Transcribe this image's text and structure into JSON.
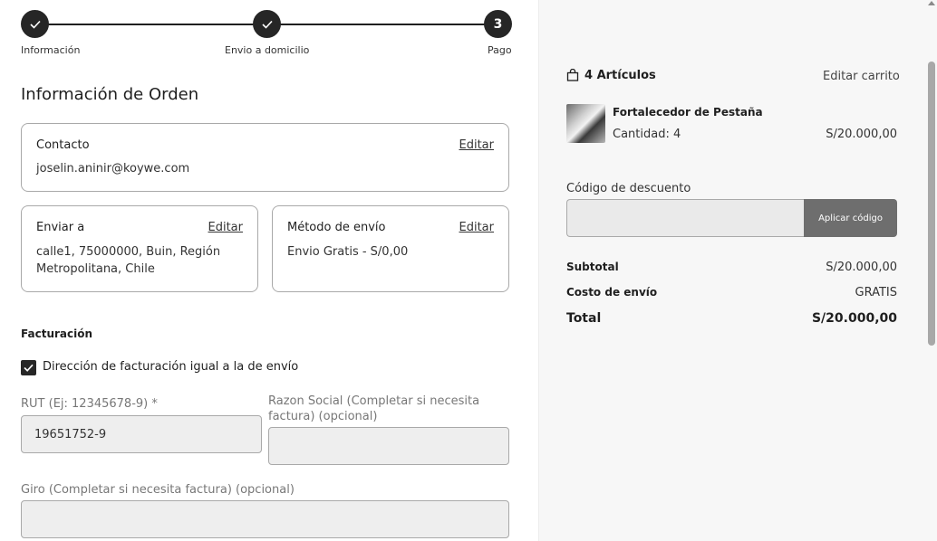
{
  "stepper": {
    "steps": [
      {
        "label": "Información",
        "state": "done",
        "icon": "check-icon"
      },
      {
        "label": "Envio a domicilio",
        "state": "done",
        "icon": "check-icon"
      },
      {
        "label": "Pago",
        "state": "current",
        "number": "3"
      }
    ]
  },
  "order": {
    "title": "Información de Orden",
    "contact": {
      "title": "Contacto",
      "edit": "Editar",
      "value": "joselin.aninir@koywe.com"
    },
    "ship_to": {
      "title": "Enviar a",
      "edit": "Editar",
      "line1": "calle1, 75000000, Buin, Región",
      "line2": "Metropolitana, Chile"
    },
    "ship_method": {
      "title": "Método de envío",
      "edit": "Editar",
      "value": "Envio Gratis - S/0,00"
    }
  },
  "billing": {
    "title": "Facturación",
    "same_as_shipping_label": "Dirección de facturación igual a la de envío",
    "same_as_shipping_checked": true,
    "rut_label": "RUT (Ej: 12345678-9) *",
    "rut_value": "19651752-9",
    "razon_label_1": "Razon Social (Completar si necesita",
    "razon_label_2": "factura) (opcional)",
    "razon_value": "",
    "giro_label": "Giro (Completar si necesita factura) (opcional)",
    "giro_value": ""
  },
  "cart": {
    "count_label": "4 Artículos",
    "edit_cart": "Editar carrito",
    "item": {
      "name": "Fortalecedor de Pestaña",
      "quantity": "Cantidad: 4",
      "price": "S/20.000,00"
    },
    "discount_label": "Código de descuento",
    "discount_placeholder": "",
    "apply_label": "Aplicar código",
    "subtotal_label": "Subtotal",
    "subtotal_value": "S/20.000,00",
    "shipping_label": "Costo de envío",
    "shipping_value": "GRATIS",
    "total_label": "Total",
    "total_value": "S/20.000,00"
  },
  "colors": {
    "dark": "#262626",
    "input_bg": "#eeeeee",
    "button": "#6e6e6e",
    "panel": "#f7f7f7"
  }
}
